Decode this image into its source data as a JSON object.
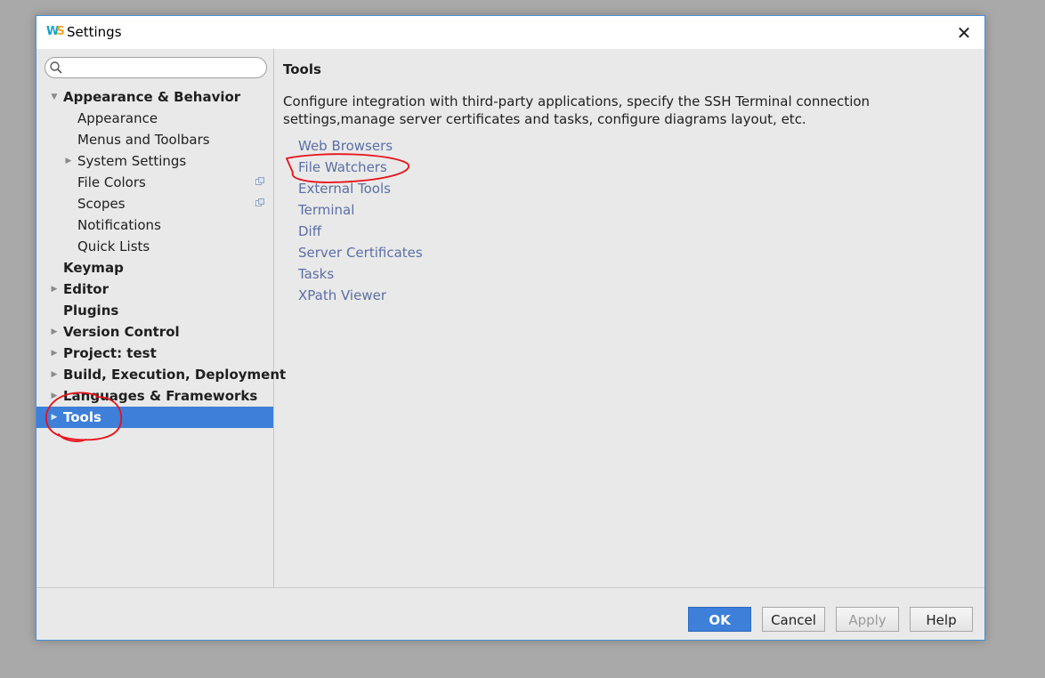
{
  "window": {
    "title": "Settings",
    "close_glyph": "✕"
  },
  "search": {
    "placeholder": "",
    "value": ""
  },
  "sidebar": {
    "items": [
      {
        "label": "Appearance & Behavior",
        "arrow": "▼"
      },
      {
        "label": "Appearance"
      },
      {
        "label": "Menus and Toolbars"
      },
      {
        "label": "System Settings",
        "arrow": "▶"
      },
      {
        "label": "File Colors"
      },
      {
        "label": "Scopes"
      },
      {
        "label": "Notifications"
      },
      {
        "label": "Quick Lists"
      },
      {
        "label": "Keymap"
      },
      {
        "label": "Editor",
        "arrow": "▶"
      },
      {
        "label": "Plugins"
      },
      {
        "label": "Version Control",
        "arrow": "▶"
      },
      {
        "label": "Project: test",
        "arrow": "▶"
      },
      {
        "label": "Build, Execution, Deployment",
        "arrow": "▶"
      },
      {
        "label": "Languages & Frameworks",
        "arrow": "▶"
      },
      {
        "label": "Tools",
        "arrow": "▶"
      }
    ]
  },
  "content": {
    "title": "Tools",
    "description": "Configure integration with third-party applications, specify the SSH Terminal connection settings,manage server certificates and tasks, configure diagrams layout, etc.",
    "links": [
      "Web Browsers",
      "File Watchers",
      "External Tools",
      "Terminal",
      "Diff",
      "Server Certificates",
      "Tasks",
      "XPath Viewer"
    ]
  },
  "buttons": {
    "ok": "OK",
    "cancel": "Cancel",
    "apply": "Apply",
    "help": "Help"
  },
  "colors": {
    "accent": "#3d7fd9",
    "link": "#5b6fa6",
    "annotation": "#e8121a"
  }
}
